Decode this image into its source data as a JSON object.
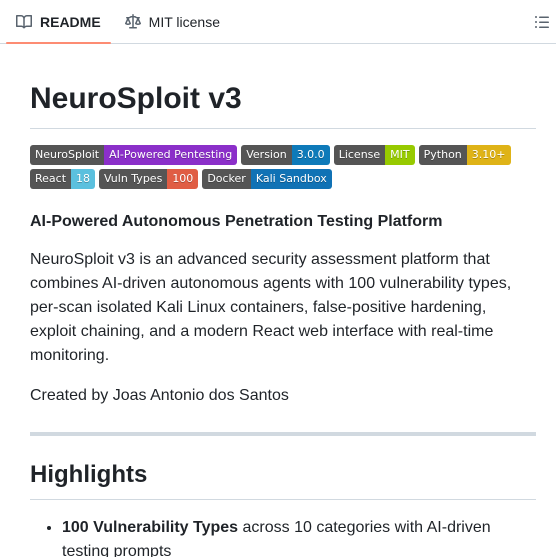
{
  "tabs": {
    "readme": "README",
    "license": "MIT license"
  },
  "readme": {
    "title": "NeuroSploit v3",
    "badges": [
      {
        "label": "NeuroSploit",
        "message": "AI-Powered Pentesting",
        "color": "#8b2fc9"
      },
      {
        "label": "Version",
        "message": "3.0.0",
        "color": "#0e7ab9"
      },
      {
        "label": "License",
        "message": "MIT",
        "color": "#97ca00"
      },
      {
        "label": "Python",
        "message": "3.10+",
        "color": "#dfb317"
      },
      {
        "label": "React",
        "message": "18",
        "color": "#5bc0de"
      },
      {
        "label": "Vuln Types",
        "message": "100",
        "color": "#e05d44"
      },
      {
        "label": "Docker",
        "message": "Kali Sandbox",
        "color": "#1072b5"
      }
    ],
    "tagline": "AI-Powered Autonomous Penetration Testing Platform",
    "description": "NeuroSploit v3 is an advanced security assessment platform that combines AI-driven autonomous agents with 100 vulnerability types, per-scan isolated Kali Linux containers, false-positive hardening, exploit chaining, and a modern React web interface with real-time monitoring.",
    "author": "Created by Joas Antonio dos Santos",
    "highlights_heading": "Highlights",
    "highlights": [
      {
        "bold": "100 Vulnerability Types",
        "text": " across 10 categories with AI-driven testing prompts"
      }
    ]
  }
}
